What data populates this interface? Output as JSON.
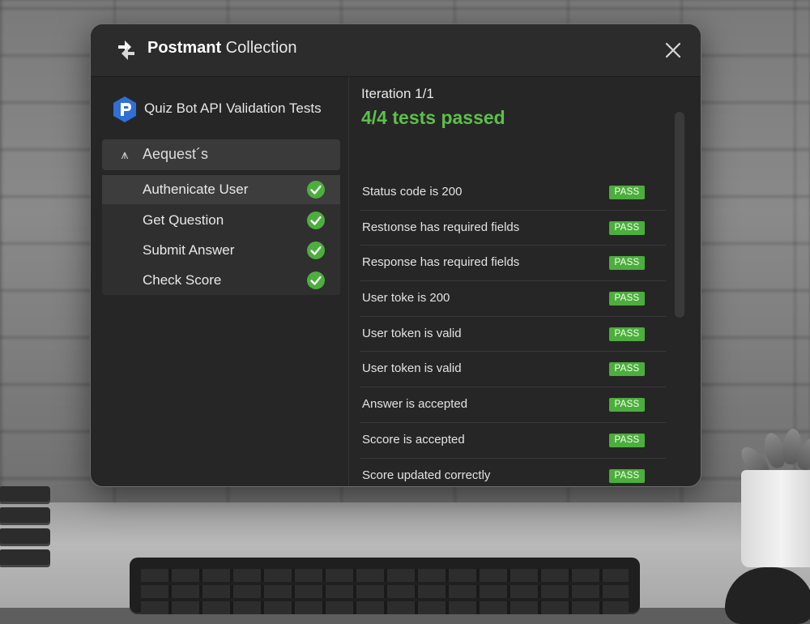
{
  "window": {
    "title_bold": "Postmant",
    "title_rest": " Collection",
    "close_icon": "close-icon"
  },
  "sidebar": {
    "collection_name": "Quiz Bot API Validation Tests",
    "requests_header": "Aequest´s",
    "requests_icon": "requests-icon",
    "items": [
      {
        "label": "Authenicate User",
        "status": "passed",
        "active": true
      },
      {
        "label": "Get Question",
        "status": "passed",
        "active": false
      },
      {
        "label": "Submit Answer",
        "status": "passed",
        "active": false
      },
      {
        "label": "Check Score",
        "status": "passed",
        "active": false
      }
    ]
  },
  "results": {
    "iteration": "Iteration 1/1",
    "summary": "4/4 tests passed",
    "tests": [
      {
        "name": "Status code is 200",
        "result": "PASS"
      },
      {
        "name": "Restıonse has required fields",
        "result": "PASS"
      },
      {
        "name": "Response has required fields",
        "result": "PASS"
      },
      {
        "name": "User toke  is 200",
        "result": "PASS"
      },
      {
        "name": "User token is valid",
        "result": "PASS"
      },
      {
        "name": "User token is valid",
        "result": "PASS"
      },
      {
        "name": "Answer is accepted",
        "result": "PASS"
      },
      {
        "name": "Sccore is accepted",
        "result": "PASS"
      },
      {
        "name": "Score updated correctly",
        "result": "PASS"
      }
    ]
  },
  "colors": {
    "pass_green": "#4cae3c",
    "summary_green": "#5cc04a",
    "window_bg": "#262626",
    "collection_icon_blue": "#2f6fd6"
  }
}
